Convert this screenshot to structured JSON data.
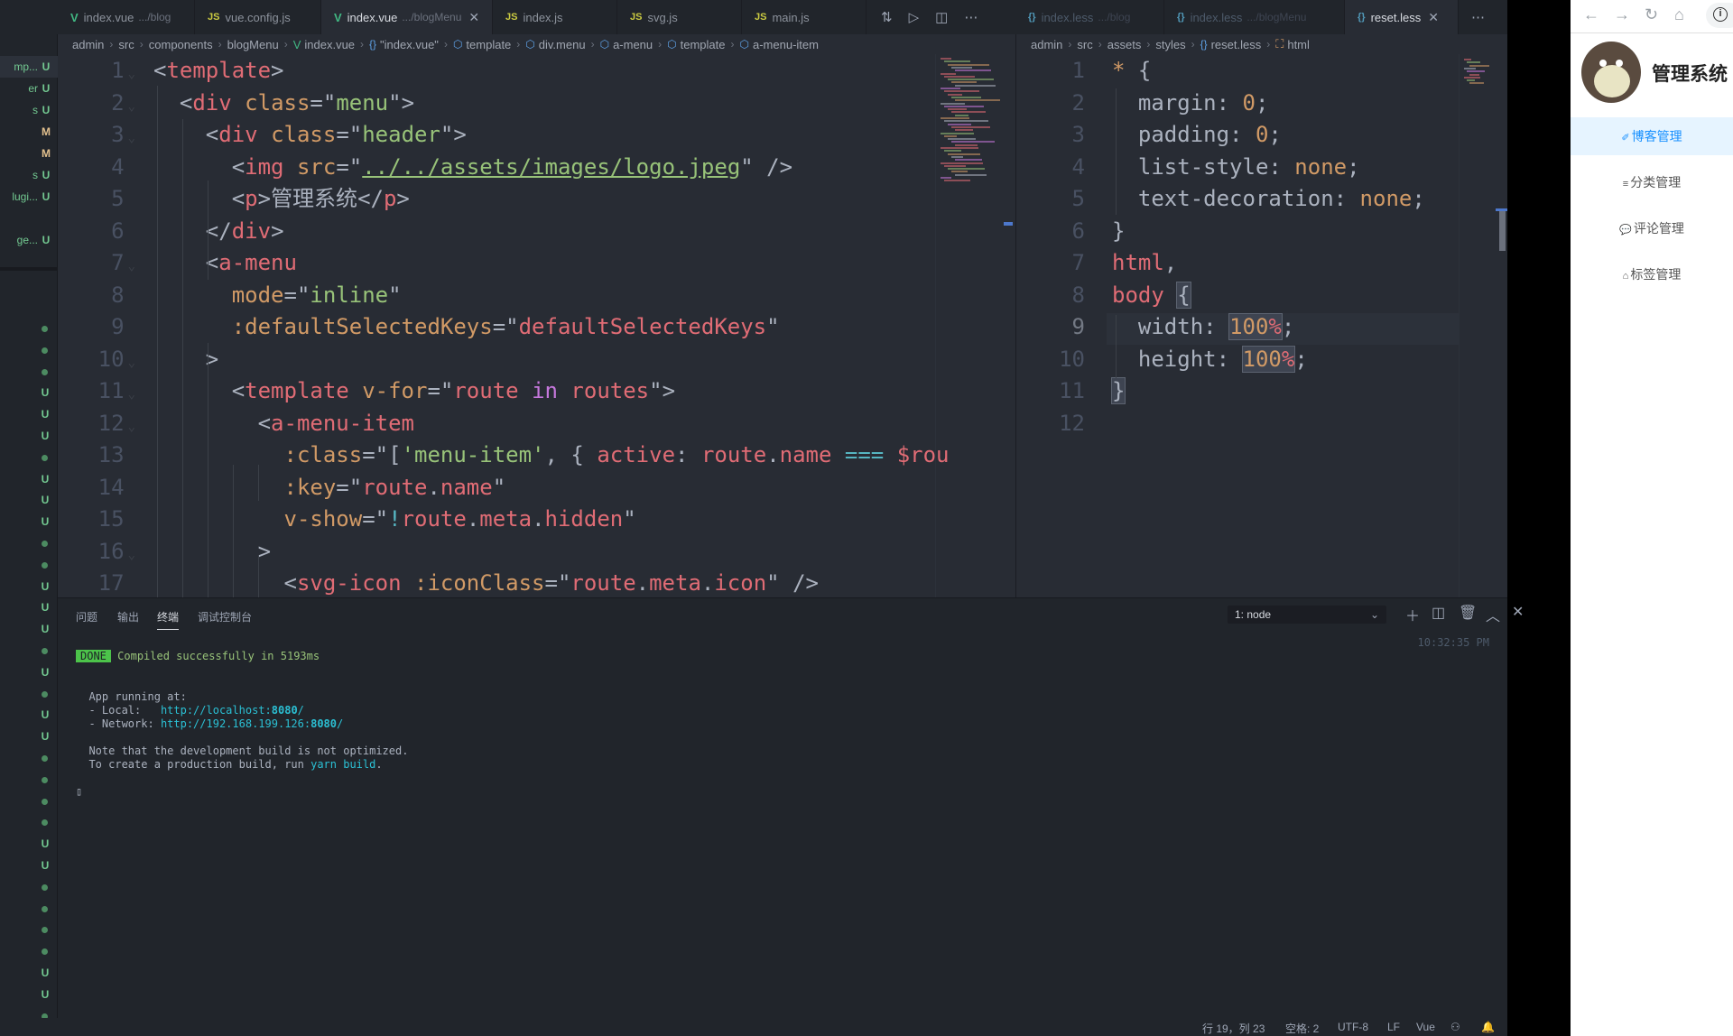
{
  "explorer": {
    "rows": [
      {
        "name": "mp...",
        "status": "U"
      },
      {
        "name": "er",
        "status": "U"
      },
      {
        "name": "s",
        "status": "U"
      },
      {
        "name": "",
        "status": "M"
      },
      {
        "name": "",
        "status": "M"
      },
      {
        "name": "s",
        "status": "U"
      },
      {
        "name": "lugi...",
        "status": "U"
      },
      {
        "name": "ge...",
        "status": "U"
      }
    ],
    "gutter_markers": [
      "dot",
      "dot",
      "dot",
      "U",
      "U",
      "U",
      "dot",
      "U",
      "U",
      "U",
      "dot",
      "dot",
      "U",
      "U",
      "U",
      "dot",
      "U",
      "dot",
      "U",
      "U",
      "dot",
      "dot",
      "dot",
      "dot",
      "U",
      "U",
      "dot",
      "dot",
      "dot",
      "dot",
      "U",
      "U",
      "dot"
    ]
  },
  "left_group": {
    "tabs": [
      {
        "icon": "vue",
        "label": "index.vue",
        "desc": ".../blog"
      },
      {
        "icon": "js",
        "label": "vue.config.js",
        "desc": ""
      },
      {
        "icon": "vue",
        "label": "index.vue",
        "desc": ".../blogMenu",
        "active": true
      },
      {
        "icon": "js",
        "label": "index.js",
        "desc": ""
      },
      {
        "icon": "js",
        "label": "svg.js",
        "desc": ""
      },
      {
        "icon": "js",
        "label": "main.js",
        "desc": ""
      }
    ],
    "breadcrumb": [
      "admin",
      "src",
      "components",
      "blogMenu",
      "index.vue",
      "\"index.vue\"",
      "template",
      "div.menu",
      "a-menu",
      "template",
      "a-menu-item"
    ],
    "line_numbers": [
      "1",
      "2",
      "3",
      "4",
      "5",
      "6",
      "7",
      "8",
      "9",
      "10",
      "11",
      "12",
      "13",
      "14",
      "15",
      "16",
      "17"
    ],
    "code": [
      "<template>",
      "  <div class=\"menu\">",
      "    <div class=\"header\">",
      "      <img src=\"../../assets/images/logo.jpeg\" />",
      "      <p>管理系统</p>",
      "    </div>",
      "    <a-menu",
      "      mode=\"inline\"",
      "      :defaultSelectedKeys=\"defaultSelectedKeys\"",
      "    >",
      "      <template v-for=\"route in routes\">",
      "        <a-menu-item",
      "          :class=\"['menu-item', { active: route.name === $rou",
      "          :key=\"route.name\"",
      "          v-show=\"!route.meta.hidden\"",
      "        >",
      "          <svg-icon :iconClass=\"route.meta.icon\" />"
    ]
  },
  "right_group": {
    "tabs": [
      {
        "icon": "less",
        "label": "index.less",
        "desc": ".../blog"
      },
      {
        "icon": "less",
        "label": "index.less",
        "desc": ".../blogMenu"
      },
      {
        "icon": "less",
        "label": "reset.less",
        "desc": "",
        "active": true
      }
    ],
    "breadcrumb": [
      "admin",
      "src",
      "assets",
      "styles",
      "reset.less",
      "html"
    ],
    "line_numbers": [
      "1",
      "2",
      "3",
      "4",
      "5",
      "6",
      "7",
      "8",
      "9",
      "10",
      "11",
      "12"
    ],
    "code": [
      "* {",
      "  margin: 0;",
      "  padding: 0;",
      "  list-style: none;",
      "  text-decoration: none;",
      "}",
      "html,",
      "body {",
      "  width: 100%;",
      "  height: 100%;",
      "}",
      ""
    ]
  },
  "panel": {
    "tabs": [
      "问题",
      "输出",
      "终端",
      "调试控制台"
    ],
    "active_tab": "终端",
    "terminal_select": "1: node",
    "timestamp": "10:32:35 PM",
    "output": {
      "done_badge": "DONE",
      "compiled": "Compiled successfully in 5193ms",
      "app_running": "App running at:",
      "local_label": "- Local:   ",
      "local_url_prefix": "http://localhost:",
      "local_port": "8080",
      "local_suffix": "/",
      "network_label": "- Network: ",
      "network_url_prefix": "http://192.168.199.126:",
      "network_port": "8080",
      "network_suffix": "/",
      "note1": "Note that the development build is not optimized.",
      "note2_prefix": "To create a production build, run ",
      "note2_cmd": "yarn build",
      "note2_suffix": ".",
      "cursor": "▯"
    }
  },
  "status_bar": {
    "position": "行 19，列 23",
    "indent": "空格: 2",
    "encoding": "UTF-8",
    "eol": "LF",
    "language": "Vue"
  },
  "browser": {
    "brand": "管理系统",
    "menu": [
      {
        "icon": "edit-icon",
        "glyph": "✐",
        "label": "博客管理",
        "active": true
      },
      {
        "icon": "list-icon",
        "glyph": "≡",
        "label": "分类管理"
      },
      {
        "icon": "comment-icon",
        "glyph": "💬",
        "label": "评论管理"
      },
      {
        "icon": "tag-icon",
        "glyph": "⌂",
        "label": "标签管理"
      }
    ]
  },
  "colors": {
    "editor_bg": "#282c34",
    "sidebar_bg": "#21252b",
    "accent_blue": "#1890ff",
    "git_untracked": "#73c991",
    "git_modified": "#e2c08d"
  }
}
